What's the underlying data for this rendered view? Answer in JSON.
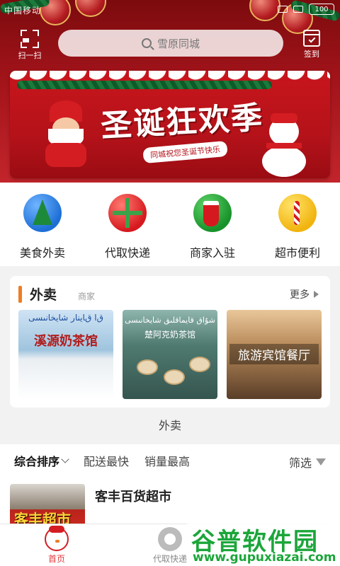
{
  "statusbar": {
    "carrier": "中国移动",
    "battery": "100"
  },
  "header": {
    "scan_label": "扫一扫",
    "search_placeholder": "雪原同城",
    "signin_label": "签到"
  },
  "banner": {
    "title": "圣诞狂欢季",
    "subtitle": "同城祝您圣诞节快乐"
  },
  "categories": [
    {
      "label": "美食外卖",
      "icon": "christmas-tree-icon"
    },
    {
      "label": "代取快递",
      "icon": "gift-bow-icon"
    },
    {
      "label": "商家入驻",
      "icon": "stocking-icon"
    },
    {
      "label": "超市便利",
      "icon": "candy-cane-icon"
    }
  ],
  "takeaway": {
    "title": "外卖",
    "tag": "商家",
    "more": "更多",
    "shops": [
      {
        "name": "溪源奶茶馆",
        "uyghur": "ﻕﺍ ﻕﺎﻳﻨﺎﺭ ﺷﺎﻳﺨﺎﻧﯩﺴﻰ"
      },
      {
        "name": "楚阿克奶茶馆",
        "uyghur": "ﺷﯘﺍﻕ ﻗﺎﻳﻤﺎﻗﻠﯩﻖ ﺷﺎﻳﺨﺎﻧﯩﺴﻰ"
      },
      {
        "name": "旅游宾馆餐厅"
      }
    ]
  },
  "section_label": "外卖",
  "sort": {
    "options": [
      "综合排序",
      "配送最快",
      "销量最高"
    ],
    "filter": "筛选"
  },
  "store": {
    "name": "客丰百货超市",
    "sign": "客丰超市"
  },
  "tabs": [
    {
      "label": "首页"
    },
    {
      "label": "代取快递"
    }
  ],
  "watermark": {
    "title": "谷普软件园",
    "url": "www.gupuxiazai.com"
  },
  "colors": {
    "accent": "#e4393c",
    "orange": "#f07c23",
    "header_red": "#a3141a"
  }
}
